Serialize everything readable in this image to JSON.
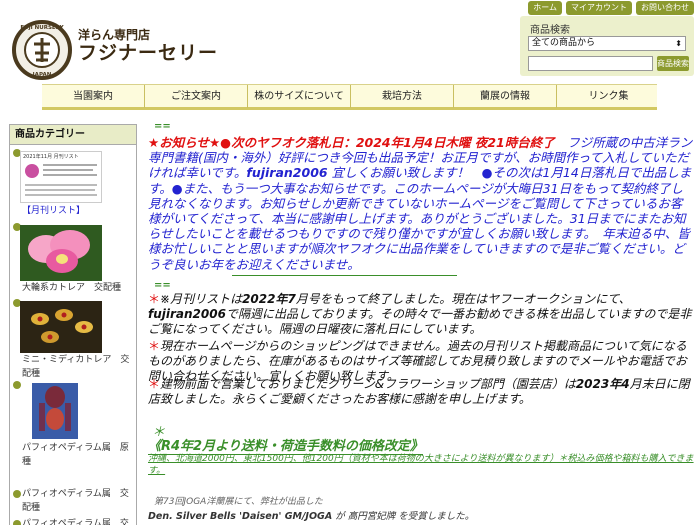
{
  "header": {
    "logo_ring_top": "FUJI NURSERY",
    "logo_ring_bottom": "JAPAN",
    "logo_mark": "士",
    "shop_type": "洋らん専門店",
    "shop_name": "フジナーセリー",
    "top_links": [
      "ホーム",
      "マイアカウント",
      "お問い合わせ"
    ]
  },
  "search": {
    "title": "商品検索",
    "select_value": "全ての商品から",
    "input_value": "",
    "button_label": "商品検索"
  },
  "nav": {
    "items": [
      "当園案内",
      "ご注文案内",
      "株のサイズについて",
      "栽培方法",
      "蘭展の情報",
      "リンク集"
    ]
  },
  "sidebar": {
    "title": "商品カテゴリー",
    "thumb_text": "2021年11月 月刊リスト",
    "categories": [
      "【月刊リスト】",
      "大輪系カトレア　交配種",
      "ミニ・ミディカトレア　交配種",
      "パフィオペディラム属　原種",
      "パフィオペディラム属　交配種",
      "パフィオペディラム属　交"
    ]
  },
  "main": {
    "divider": "==",
    "notice": {
      "line1_red": "★お知らせ★●次のヤフオク落札日：2024年1月4日木曜 夜21時台終了",
      "line1_rest": "　フジ所蔵の中古洋ラン専門書籍(国内・海外）好評につき今回も出品予定！お正月ですが、お時間作って入札していただければ幸いです。",
      "fujiran": "fujiran2006",
      "line2": " 宜しくお願い致します！　●その次は1月14日落札日で出品します。●また、もう一つ大事なお知らせです。このホームページが大晦日31日をもって契約終了し見れなくなります。お知らせしか更新できていないホームページをご覧問して下さっているお客様がいてくださって、本当に感謝申し上げます。ありがとうございました。31日までにまたお知らせしたいことを載せるつもりですので残り僅かですが宜しくお願い致します。　年末迫る中、皆様お忙しいことと思いますが順次ヤフオクに出品作業をしていきますので是非ご覧ください。どうぞ良いお年をお迎えくださいませ。"
    },
    "news": [
      {
        "ast": "＊",
        "text_a": "※月刊リストは",
        "bold_a": "2022年7",
        "text_b": "月号をもって終了しました。現在はヤフーオークションにて、",
        "bold_b": "fujiran2006",
        "text_c": "で隔週に出品しております。その時々で一番お勧めできる株を出品していますので是非ご覧になってください。隔週の日曜夜に落札日にしています。"
      },
      {
        "ast": "＊",
        "text_a": "現在ホームページからのショッピングはできません。過去の月刊リスト掲載商品について気になるものがありましたら、在庫があるものはサイズ等確認してお見積り致しますのでメールやお電話でお問い合わせください。宜しくお願い致します。"
      },
      {
        "ast": "＊",
        "text_a": "建物前面で営業しておりましたグリーン&フラワーショップ部門（園芸店）は",
        "bold_a": "2023年4",
        "text_b": "月末日に閉店致しました。永らくご愛顧くださったお客様に感謝を申し上げます。"
      }
    ],
    "shipping": {
      "ast": "＊",
      "title": "《R4年2月より送料・荷造手数料の価格改定》",
      "detail": "沖縄、北海道2000円、東北1500円、他1200円（資材や本は荷物の大きさにより送料が異なります）＊税込み価格や箱料も購入できます。"
    },
    "joga": {
      "line1": "第73回JOGA洋蘭展にて、弊社が出品した",
      "award_name": "Den. Silver Bells 'Daisen' GM/JOGA",
      "line2": " が 高円宮妃牌 を受賞しました。"
    }
  },
  "colors": {
    "olive": "#8c9a2e",
    "notice_blue": "#2323d0",
    "alert_red": "#e01010",
    "green_text": "#3a8f2a",
    "nav_bg": "#fdfbdc",
    "search_bg": "#ecf0cc"
  }
}
